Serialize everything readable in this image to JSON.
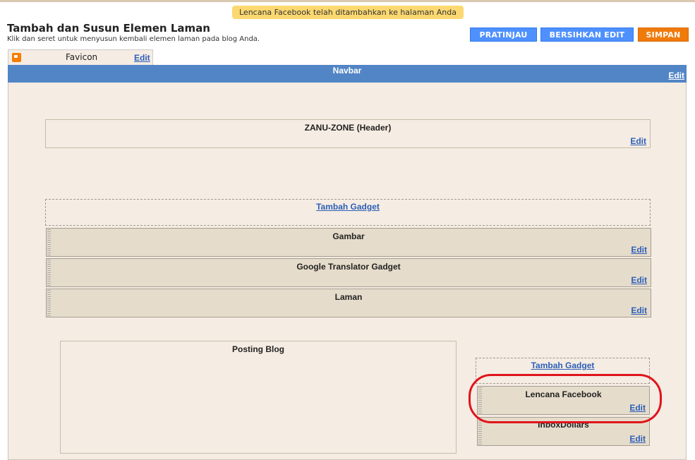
{
  "notice": {
    "text": "Lencana Facebook telah ditambahkan ke halaman Anda"
  },
  "header": {
    "title": "Tambah dan Susun Elemen Laman",
    "subtitle": "Klik dan seret untuk menyusun kembali elemen laman pada blog Anda."
  },
  "toolbar": {
    "preview_label": "PRATINJAU",
    "clear_label": "BERSIHKAN EDIT",
    "save_label": "SIMPAN"
  },
  "favicon": {
    "label": "Favicon",
    "edit": "Edit"
  },
  "navbar": {
    "label": "Navbar",
    "edit": "Edit"
  },
  "header_widget": {
    "label": "ZANU-ZONE (Header)",
    "edit": "Edit"
  },
  "top_section": {
    "add_gadget": "Tambah Gadget",
    "widgets": [
      {
        "label": "Gambar",
        "edit": "Edit"
      },
      {
        "label": "Google Translator Gadget",
        "edit": "Edit"
      },
      {
        "label": "Laman",
        "edit": "Edit"
      }
    ]
  },
  "main_column": {
    "label": "Posting Blog"
  },
  "sidebar": {
    "add_gadget": "Tambah Gadget",
    "widgets": [
      {
        "label": "Lencana Facebook",
        "edit": "Edit"
      },
      {
        "label": "InboxDollars",
        "edit": "Edit"
      }
    ]
  },
  "colors": {
    "navbar": "#5285c5",
    "button_blue": "#4d90fe",
    "button_orange": "#f07a0a",
    "notice": "#fcd870",
    "highlight": "#e0141b"
  },
  "icons": {
    "favicon": "blogger-icon"
  }
}
